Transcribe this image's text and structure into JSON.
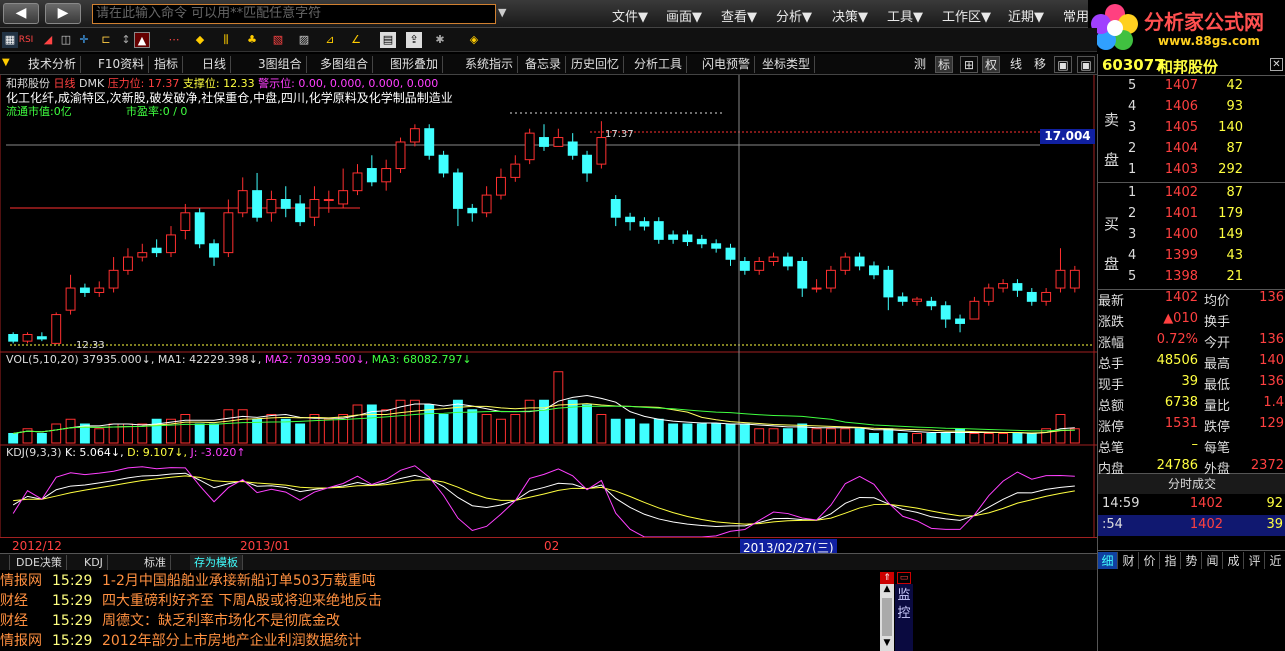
{
  "menubar": {
    "command_placeholder": "请在此输入命令  可以用**匹配任意字符",
    "menus": [
      "文件▼",
      "画面▼",
      "查看▼",
      "分析▼",
      "决策▼",
      "工具▼",
      "工作区▼",
      "近期▼",
      "常用"
    ]
  },
  "logo": {
    "text": "分析家公式网",
    "url": "www.88gs.com"
  },
  "toolbar_tabs": [
    "技术分析",
    "F10资料",
    "指标",
    "日线",
    "3图组合",
    "多图组合",
    "图形叠加",
    "系统指示",
    "备忘录",
    "历史回忆",
    "分析工具",
    "闪电预警",
    "坐标类型"
  ],
  "toolbar_right": [
    "测",
    "标",
    "⊞",
    "权",
    "线",
    "移",
    "▣",
    "▣"
  ],
  "chart_header": {
    "name": "和邦股份",
    "period": "日线",
    "dmk": "DMK",
    "pressure_label": "压力位:",
    "pressure": "17.37",
    "support_label": "支撑位:",
    "support": "12.33",
    "alert_label": "警示位:",
    "alert_vals": "0.00, 0.000, 0.000, 0.000",
    "sectors": "化工化纤,成渝特区,次新股,破发破净,社保重仓,中盘,四川,化学原料及化学制品制造业",
    "circ_label": "流通市值:0亿",
    "pe_label": "市盈率:0 / 0",
    "price_tag": "17.004",
    "high_label": "17.37",
    "low_label": "12.33"
  },
  "vol_header": {
    "title": "VOL(5,10,20)",
    "v": "37935.000↓,",
    "ma1": "MA1: 42229.398↓,",
    "ma2": "MA2: 70399.500↓,",
    "ma3": "MA3: 68082.797↓"
  },
  "kdj_header": {
    "title": "KDJ(9,3,3)",
    "k": "K: 5.064↓,",
    "d": "D: 9.107↓,",
    "j": "J: -3.020↑"
  },
  "x_axis": {
    "labels": [
      "2012/12",
      "2013/01",
      "02"
    ],
    "cursor_date": "2013/02/27(三)"
  },
  "colors": {
    "up": "#ff3030",
    "down": "#40ffff",
    "up_fill": "#000",
    "ma1": "#ffffff",
    "ma2": "#ffff60",
    "ma3": "#ff40ff"
  },
  "chart_data": {
    "type": "candlestick",
    "candles": [
      [
        12.55,
        12.4,
        12.6,
        12.35
      ],
      [
        12.4,
        12.55,
        12.6,
        12.35
      ],
      [
        12.5,
        12.45,
        12.6,
        12.4
      ],
      [
        12.35,
        13.0,
        13.05,
        12.33
      ],
      [
        13.1,
        13.6,
        13.9,
        13.0
      ],
      [
        13.6,
        13.5,
        13.7,
        13.4
      ],
      [
        13.5,
        13.6,
        13.75,
        13.4
      ],
      [
        13.6,
        14.0,
        14.3,
        13.5
      ],
      [
        14.0,
        14.3,
        14.5,
        13.9
      ],
      [
        14.3,
        14.4,
        14.6,
        14.2
      ],
      [
        14.5,
        14.4,
        14.7,
        14.3
      ],
      [
        14.4,
        14.8,
        15.0,
        14.3
      ],
      [
        14.9,
        15.3,
        15.5,
        14.7
      ],
      [
        15.3,
        14.6,
        15.4,
        14.5
      ],
      [
        14.6,
        14.3,
        14.7,
        14.1
      ],
      [
        14.4,
        15.3,
        15.6,
        14.3
      ],
      [
        15.3,
        15.8,
        16.1,
        15.2
      ],
      [
        15.8,
        15.2,
        16.2,
        15.1
      ],
      [
        15.3,
        15.6,
        15.8,
        15.1
      ],
      [
        15.6,
        15.4,
        15.9,
        15.2
      ],
      [
        15.5,
        15.1,
        15.7,
        15.0
      ],
      [
        15.2,
        15.6,
        15.9,
        15.0
      ],
      [
        15.6,
        15.6,
        15.8,
        15.3
      ],
      [
        15.5,
        15.8,
        16.3,
        15.4
      ],
      [
        15.8,
        16.2,
        16.4,
        15.7
      ],
      [
        16.3,
        16.0,
        16.6,
        15.9
      ],
      [
        16.0,
        16.3,
        16.5,
        15.8
      ],
      [
        16.3,
        16.9,
        17.0,
        16.2
      ],
      [
        16.9,
        17.2,
        17.3,
        16.8
      ],
      [
        17.2,
        16.6,
        17.3,
        16.5
      ],
      [
        16.6,
        16.2,
        16.7,
        16.1
      ],
      [
        16.2,
        15.4,
        16.3,
        15.0
      ],
      [
        15.4,
        15.3,
        15.5,
        15.1
      ],
      [
        15.3,
        15.7,
        15.9,
        15.2
      ],
      [
        15.7,
        16.1,
        16.3,
        15.6
      ],
      [
        16.1,
        16.4,
        16.6,
        16.0
      ],
      [
        16.5,
        17.1,
        17.2,
        16.4
      ],
      [
        17.0,
        16.8,
        17.3,
        16.7
      ],
      [
        16.8,
        17.0,
        17.2,
        16.8
      ],
      [
        16.9,
        16.6,
        17.1,
        16.5
      ],
      [
        16.6,
        16.2,
        16.7,
        16.0
      ],
      [
        16.4,
        17.0,
        17.37,
        16.3
      ],
      [
        15.6,
        15.2,
        15.7,
        15.0
      ],
      [
        15.2,
        15.1,
        15.3,
        14.9
      ],
      [
        15.1,
        15.0,
        15.2,
        14.9
      ],
      [
        15.1,
        14.7,
        15.2,
        14.6
      ],
      [
        14.8,
        14.7,
        14.9,
        14.6
      ],
      [
        14.8,
        14.65,
        14.9,
        14.55
      ],
      [
        14.7,
        14.6,
        14.8,
        14.5
      ],
      [
        14.6,
        14.5,
        14.7,
        14.4
      ],
      [
        14.5,
        14.25,
        14.6,
        14.1
      ],
      [
        14.2,
        14.0,
        14.3,
        13.9
      ],
      [
        14.0,
        14.2,
        14.3,
        13.9
      ],
      [
        14.2,
        14.3,
        14.4,
        14.1
      ],
      [
        14.3,
        14.1,
        14.4,
        14.0
      ],
      [
        14.2,
        13.6,
        14.3,
        13.4
      ],
      [
        13.6,
        13.6,
        13.8,
        13.5
      ],
      [
        13.6,
        14.0,
        14.1,
        13.5
      ],
      [
        14.0,
        14.3,
        14.4,
        13.9
      ],
      [
        14.3,
        14.1,
        14.4,
        14.0
      ],
      [
        14.1,
        13.9,
        14.2,
        13.8
      ],
      [
        14.0,
        13.4,
        14.1,
        13.1
      ],
      [
        13.4,
        13.3,
        13.5,
        13.2
      ],
      [
        13.3,
        13.35,
        13.4,
        13.2
      ],
      [
        13.3,
        13.2,
        13.4,
        13.1
      ],
      [
        13.2,
        12.9,
        13.3,
        12.7
      ],
      [
        12.9,
        12.8,
        13.0,
        12.6
      ],
      [
        12.9,
        13.3,
        13.4,
        12.9
      ],
      [
        13.3,
        13.6,
        13.7,
        13.2
      ],
      [
        13.6,
        13.7,
        13.8,
        13.5
      ],
      [
        13.7,
        13.55,
        13.8,
        13.4
      ],
      [
        13.5,
        13.3,
        13.6,
        13.2
      ],
      [
        13.3,
        13.5,
        13.6,
        13.2
      ],
      [
        13.6,
        14.0,
        14.5,
        13.5
      ],
      [
        13.6,
        14.0,
        14.1,
        13.5
      ]
    ],
    "ylim": [
      12.2,
      17.6
    ],
    "volumes": [
      2,
      3,
      2,
      4,
      5,
      4,
      3,
      4,
      4,
      4,
      5,
      5,
      6,
      4,
      4,
      7,
      7,
      5,
      6,
      5,
      4,
      6,
      5,
      6,
      8,
      8,
      7,
      9,
      9,
      8,
      6,
      9,
      7,
      6,
      5,
      6,
      9,
      9,
      15,
      9,
      8,
      6,
      5,
      5,
      4,
      5,
      4,
      4,
      4,
      4,
      4,
      4,
      3,
      3,
      3,
      4,
      3,
      3,
      3,
      3,
      2,
      3,
      2,
      2,
      2,
      2,
      3,
      2,
      2,
      2,
      2,
      2,
      3,
      6,
      3
    ],
    "vol_ylim": [
      0,
      16
    ]
  },
  "quote": {
    "code": "603077",
    "name": "和邦股份",
    "sell_label": "卖盘",
    "buy_label": "买盘",
    "asks": [
      [
        "5",
        "1407",
        "42"
      ],
      [
        "4",
        "1406",
        "93"
      ],
      [
        "3",
        "1405",
        "140"
      ],
      [
        "2",
        "1404",
        "87"
      ],
      [
        "1",
        "1403",
        "292"
      ]
    ],
    "bids": [
      [
        "1",
        "1402",
        "87"
      ],
      [
        "2",
        "1401",
        "179"
      ],
      [
        "3",
        "1400",
        "149"
      ],
      [
        "4",
        "1399",
        "43"
      ],
      [
        "5",
        "1398",
        "21"
      ]
    ],
    "stats": [
      [
        "最新",
        "1402",
        "均价",
        "136"
      ],
      [
        "涨跌",
        "▲010",
        "换手",
        ""
      ],
      [
        "涨幅",
        "0.72%",
        "今开",
        "136"
      ],
      [
        "总手",
        "48506",
        "最高",
        "140"
      ],
      [
        "现手",
        "39",
        "最低",
        "136"
      ],
      [
        "总额",
        "6738",
        "量比",
        "1.4"
      ],
      [
        "涨停",
        "1531",
        "跌停",
        "129"
      ],
      [
        "总笔",
        "–",
        "每笔",
        ""
      ],
      [
        "内盘",
        "24786",
        "外盘",
        "2372"
      ]
    ],
    "ticks_title": "分时成交",
    "ticks": [
      [
        "14:59",
        "1402",
        "92"
      ],
      [
        ":54",
        "1402",
        "39"
      ]
    ],
    "bottom_tabs": [
      "细",
      "财",
      "价",
      "指",
      "势",
      "闻",
      "成",
      "评",
      "近"
    ]
  },
  "bottom_tabs": [
    "DDE决策",
    "KDJ",
    "标准",
    "存为模板"
  ],
  "news": [
    {
      "src": "情报网",
      "time": "15:29",
      "title": "1-2月中国船舶业承接新船订单503万载重吨"
    },
    {
      "src": "财经",
      "time": "15:29",
      "title": "四大重磅利好齐至 下周A股或将迎来绝地反击"
    },
    {
      "src": "财经",
      "time": "15:29",
      "title": "周德文：缺乏利率市场化不是彻底金改"
    },
    {
      "src": "情报网",
      "time": "15:29",
      "title": "2012年部分上市房地产企业利润数据统计"
    }
  ],
  "monitor_label": "监控"
}
